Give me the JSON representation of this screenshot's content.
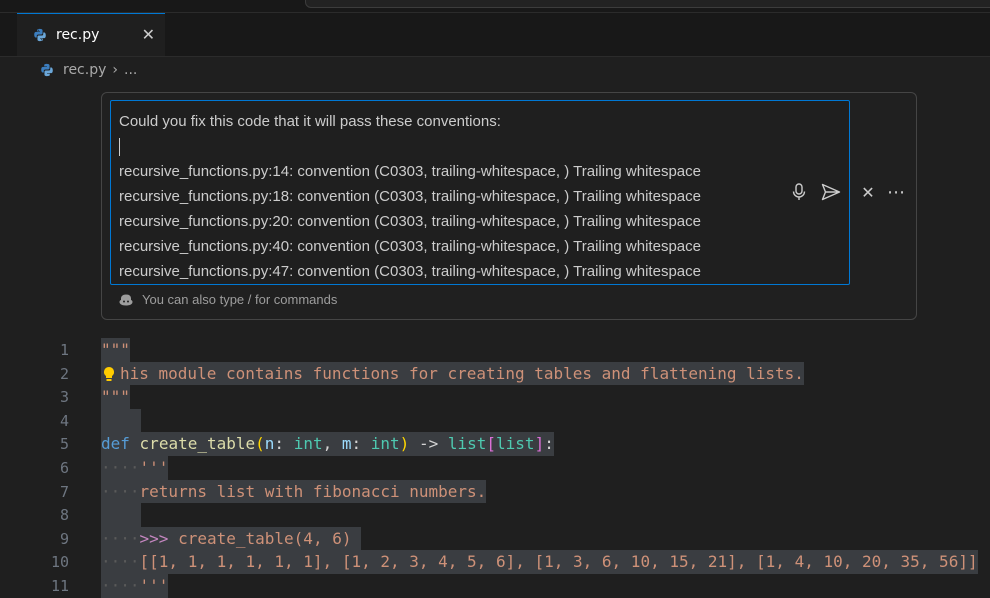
{
  "tab": {
    "filename": "rec.py",
    "close_glyph": "✕"
  },
  "breadcrumb": {
    "file": "rec.py",
    "separator": "›",
    "ellipsis": "..."
  },
  "chat": {
    "message_lines": [
      "Could you fix this code that it will pass these conventions:",
      "recursive_functions.py:14: convention (C0303, trailing-whitespace, ) Trailing whitespace",
      "recursive_functions.py:18: convention (C0303, trailing-whitespace, ) Trailing whitespace",
      "recursive_functions.py:20: convention (C0303, trailing-whitespace, ) Trailing whitespace",
      "recursive_functions.py:40: convention (C0303, trailing-whitespace, ) Trailing whitespace",
      "recursive_functions.py:47: convention (C0303, trailing-whitespace, ) Trailing whitespace"
    ],
    "hint": "You can also type / for commands",
    "icons": [
      "microphone-icon",
      "send-icon",
      "close-icon",
      "more-icon",
      "copilot-icon"
    ],
    "more_glyph": "⋯",
    "close_glyph": "✕"
  },
  "editor": {
    "line_numbers": [
      "1",
      "2",
      "3",
      "4",
      "5",
      "6",
      "7",
      "8",
      "9",
      "10",
      "11"
    ],
    "line1": "\"\"\"",
    "line2": "his module contains functions for creating tables and flattening lists.",
    "line3": "\"\"\"",
    "line5": {
      "kw": "def",
      "fn": "create_table",
      "p1": "n",
      "t1": "int",
      "p2": "m",
      "t2": "int",
      "arrow": "->",
      "rt1": "list",
      "rt2": "list"
    },
    "line6": "'''",
    "line7": "returns list with fibonacci numbers.",
    "line9": {
      "prompt": ">>>",
      "call": "create_table(4, 6)"
    },
    "line10": "[[1, 1, 1, 1, 1, 1], [1, 2, 3, 4, 5, 6], [1, 3, 6, 10, 15, 21], [1, 4, 10, 20, 35, 56]]",
    "line11": "'''"
  },
  "colors": {
    "accent": "#0078d4",
    "string": "#ce9178",
    "keyword": "#569cd6",
    "selection": "#3a3d41"
  }
}
